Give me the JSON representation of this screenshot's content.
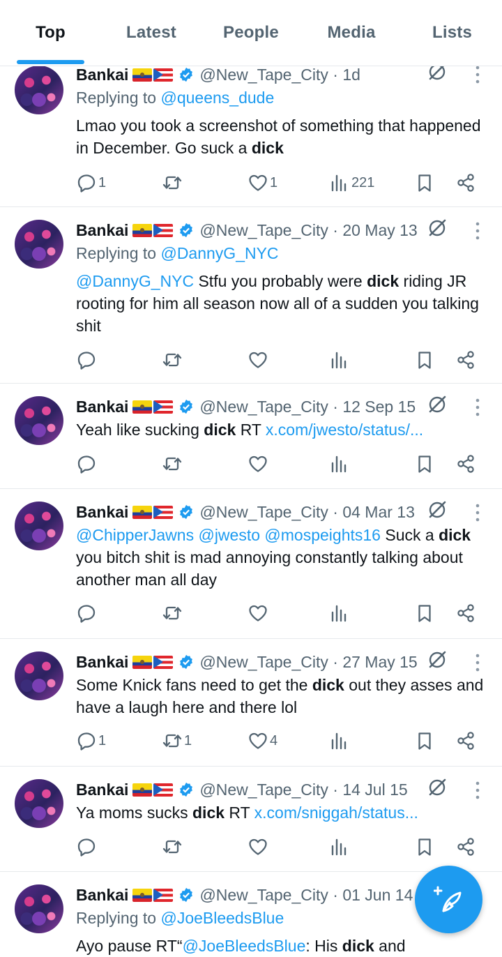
{
  "tabs": [
    {
      "label": "Top",
      "active": true
    },
    {
      "label": "Latest",
      "active": false
    },
    {
      "label": "People",
      "active": false
    },
    {
      "label": "Media",
      "active": false
    },
    {
      "label": "Lists",
      "active": false
    }
  ],
  "accent_color": "#1d9bf0",
  "author": {
    "name": "Bankai",
    "handle": "@New_Tape_City",
    "flags": [
      "ecuador-flag",
      "puerto-rico-flag"
    ],
    "verified": true
  },
  "tweets": [
    {
      "date": "1d",
      "replying_prefix": "Replying to ",
      "replying_to": "@queens_dude",
      "text_before": "Lmao you took a screenshot of something that happened in December. Go suck a ",
      "highlight": "dick",
      "text_after": "",
      "mentions": "",
      "link": "",
      "stats": {
        "replies": "1",
        "reposts": "",
        "likes": "1",
        "views": "221"
      }
    },
    {
      "date": "20 May 13",
      "replying_prefix": "Replying to ",
      "replying_to": "@DannyG_NYC",
      "mentions": "@DannyG_NYC",
      "text_before": " Stfu you probably were ",
      "highlight": "dick",
      "text_after": " riding JR rooting for him all season now all of a sudden you talking shit",
      "link": "",
      "stats": {
        "replies": "",
        "reposts": "",
        "likes": "",
        "views": ""
      }
    },
    {
      "date": "12 Sep 15",
      "mentions": "",
      "text_before": "Yeah like sucking ",
      "highlight": "dick",
      "text_after": " RT ",
      "link": "x.com/jwesto/status/...",
      "stats": {
        "replies": "",
        "reposts": "",
        "likes": "",
        "views": ""
      }
    },
    {
      "date": "04 Mar 13",
      "mentions": "@ChipperJawns @jwesto @mospeights16",
      "text_before": " Suck a ",
      "highlight": "dick",
      "text_after": " you bitch shit is mad annoying constantly talking about another man all day",
      "link": "",
      "stats": {
        "replies": "",
        "reposts": "",
        "likes": "",
        "views": ""
      }
    },
    {
      "date": "27 May 15",
      "mentions": "",
      "text_before": "Some Knick fans need to get the ",
      "highlight": "dick",
      "text_after": " out they asses and have a laugh here and there lol",
      "link": "",
      "stats": {
        "replies": "1",
        "reposts": "1",
        "likes": "4",
        "views": ""
      }
    },
    {
      "date": "14 Jul 15",
      "mentions": "",
      "text_before": "Ya moms sucks ",
      "highlight": "dick",
      "text_after": " RT ",
      "link": "x.com/sniggah/status...",
      "stats": {
        "replies": "",
        "reposts": "",
        "likes": "",
        "views": ""
      }
    },
    {
      "date": "01 Jun 14",
      "replying_prefix": "Replying to ",
      "replying_to": "@JoeBleedsBlue",
      "text_before": "Ayo pause RT“",
      "mention_inline": "@JoeBleedsBlue",
      "text_mid": ": His ",
      "highlight": "dick",
      "text_after": " and"
    }
  ],
  "icons": {
    "reply": "reply-icon",
    "repost": "repost-icon",
    "like": "like-icon",
    "views": "views-icon",
    "bookmark": "bookmark-icon",
    "share": "share-icon",
    "grok": "grok-icon",
    "more": "more-icon",
    "compose": "compose-icon"
  }
}
